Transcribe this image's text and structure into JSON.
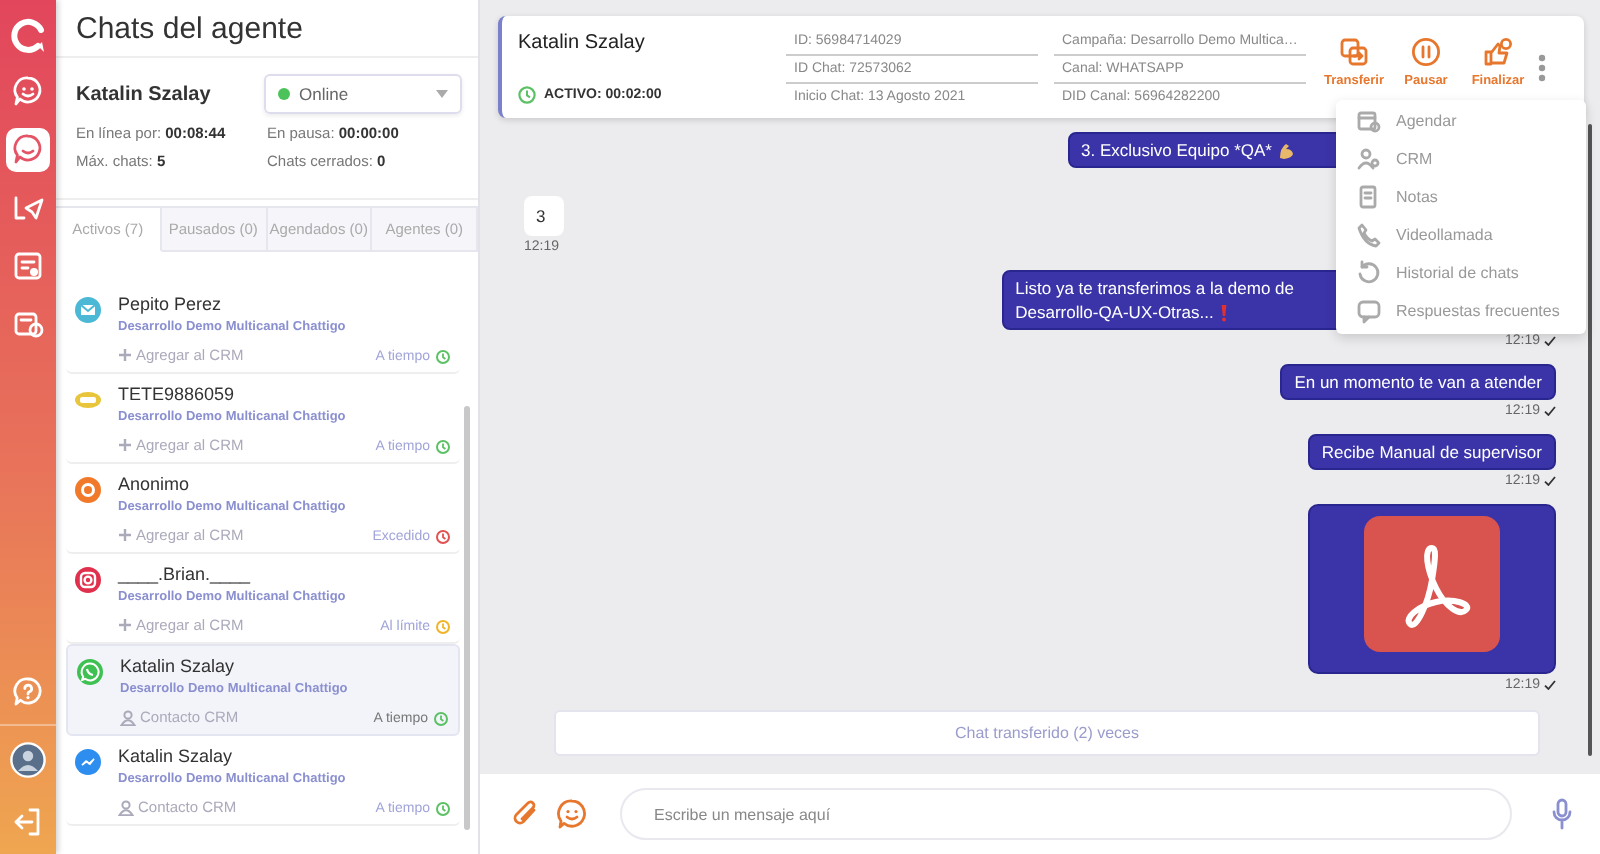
{
  "rail": {
    "items": [
      {
        "kind": "bot",
        "selected": false
      },
      {
        "kind": "chat",
        "selected": true
      },
      {
        "kind": "campaign",
        "selected": false
      },
      {
        "kind": "reports",
        "selected": false
      },
      {
        "kind": "schedule",
        "selected": false
      }
    ],
    "bottom": [
      {
        "kind": "help"
      },
      {
        "kind": "avatar"
      },
      {
        "kind": "logout"
      }
    ]
  },
  "panel": {
    "title": "Chats del agente",
    "agent": {
      "name": "Katalin Szalay",
      "status": "Online",
      "stats": [
        {
          "label": "En línea por:",
          "value": "00:08:44"
        },
        {
          "label": "En pausa:",
          "value": "00:00:00"
        },
        {
          "label": "Máx. chats:",
          "value": "5"
        },
        {
          "label": "Chats cerrados:",
          "value": "0"
        }
      ]
    },
    "tabs": [
      {
        "label": "Activos (7)",
        "selected": true
      },
      {
        "label": "Pausados (0)",
        "selected": false
      },
      {
        "label": "Agendados (0)",
        "selected": false
      },
      {
        "label": "Agentes (0)",
        "selected": false
      }
    ],
    "chats": [
      {
        "kind": "email",
        "name": "Pepito Perez",
        "campaign": "Desarrollo Demo Multicanal Chattigo",
        "crm": {
          "kind": "add",
          "label": "Agregar al CRM"
        },
        "status": {
          "label": "A tiempo",
          "color": "#5cc165"
        },
        "selected": false
      },
      {
        "kind": "sms",
        "name": "TETE9886059",
        "campaign": "Desarrollo Demo Multicanal Chattigo",
        "crm": {
          "kind": "add",
          "label": "Agregar al CRM"
        },
        "status": {
          "label": "A tiempo",
          "color": "#5cc165"
        },
        "selected": false
      },
      {
        "kind": "webchat",
        "name": "Anonimo",
        "campaign": "Desarrollo Demo Multicanal Chattigo",
        "crm": {
          "kind": "add",
          "label": "Agregar al CRM"
        },
        "status": {
          "label": "Excedido",
          "color": "#e25252"
        },
        "selected": false
      },
      {
        "kind": "instagram",
        "name": "____.Brian.____",
        "campaign": "Desarrollo Demo Multicanal Chattigo",
        "crm": {
          "kind": "add",
          "label": "Agregar al CRM"
        },
        "status": {
          "label": "Al límite",
          "color": "#f0b429"
        },
        "selected": false
      },
      {
        "kind": "whatsapp",
        "name": "Katalin Szalay",
        "campaign": "Desarrollo Demo Multicanal Chattigo",
        "crm": {
          "kind": "contact",
          "label": "Contacto CRM"
        },
        "status": {
          "label": "A tiempo",
          "color": "#5cc165"
        },
        "selected": true
      },
      {
        "kind": "messenger",
        "name": "Katalin Szalay",
        "campaign": "Desarrollo Demo Multicanal Chattigo",
        "crm": {
          "kind": "contact",
          "label": "Contacto CRM"
        },
        "status": {
          "label": "A tiempo",
          "color": "#5cc165"
        },
        "selected": false
      }
    ]
  },
  "chat": {
    "header": {
      "name": "Katalin Szalay",
      "active": "ACTIVO: 00:02:00",
      "info": [
        "ID: 56984714029",
        "Campaña: Desarrollo Demo Multica…",
        "ID Chat: 72573062",
        "Canal: WHATSAPP",
        "Inicio Chat: 13 Agosto 2021",
        "DID Canal: 56964282200"
      ],
      "actions": [
        {
          "kind": "transfer",
          "label": "Transferir"
        },
        {
          "kind": "pause",
          "label": "Pausar"
        },
        {
          "kind": "finish",
          "label": "Finalizar"
        }
      ]
    },
    "menu": [
      {
        "kind": "schedule",
        "label": "Agendar"
      },
      {
        "kind": "crm",
        "label": "CRM"
      },
      {
        "kind": "notes",
        "label": "Notas"
      },
      {
        "kind": "video",
        "label": "Videollamada"
      },
      {
        "kind": "history",
        "label": "Historial de chats"
      },
      {
        "kind": "faq",
        "label": "Respuestas frecuentes"
      }
    ],
    "messages": [
      {
        "kind": "out",
        "lines": [
          "3. Exclusivo Equipo *QA*"
        ],
        "icon": {
          "kind": "arm"
        }
      },
      {
        "kind": "in",
        "lines": [
          "3"
        ],
        "time": "12:19"
      },
      {
        "kind": "out",
        "lines": [
          "Listo ya te transferimos a la demo de",
          "Desarrollo-QA-UX-Otras..."
        ],
        "icon": {
          "kind": "alert"
        },
        "time": "12:19"
      },
      {
        "kind": "out",
        "lines": [
          "En un momento te van a atender"
        ],
        "time": "12:19"
      },
      {
        "kind": "out",
        "lines": [
          "Recibe Manual de supervisor"
        ],
        "time": "12:19"
      },
      {
        "kind": "file",
        "time": "12:19"
      }
    ],
    "notice": "Chat transferido (2) veces",
    "composer": {
      "placeholder": "Escribe un mensaje aquí"
    }
  }
}
